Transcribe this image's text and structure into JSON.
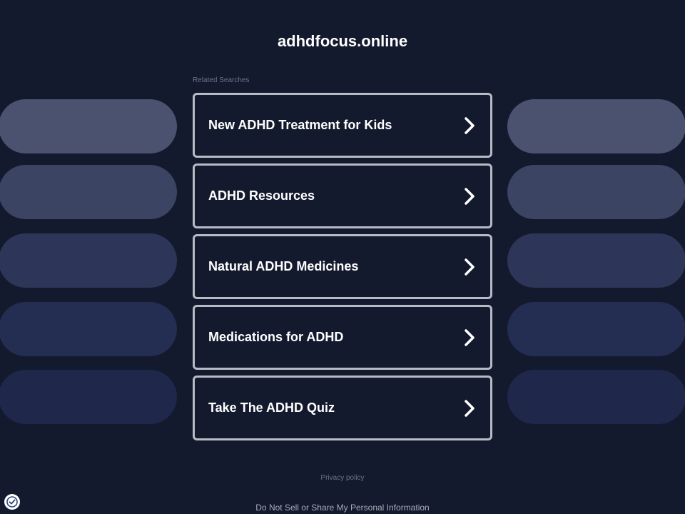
{
  "site": {
    "title": "adhdfocus.online"
  },
  "related": {
    "label": "Related Searches",
    "links": [
      {
        "label": "New ADHD Treatment for Kids"
      },
      {
        "label": "ADHD Resources"
      },
      {
        "label": "Natural ADHD Medicines"
      },
      {
        "label": "Medications for ADHD"
      },
      {
        "label": "Take The ADHD Quiz"
      }
    ]
  },
  "footer": {
    "privacy": "Privacy policy",
    "do_not_sell": "Do Not Sell or Share My Personal Information"
  },
  "icons": {
    "link_arrow": "chevron-right-icon",
    "consent": "privacy-consent-icon"
  },
  "colors": {
    "background": "#141a2e",
    "card_border": "#b7bbc4",
    "decor_shades": [
      "#4a5270",
      "#3b4463",
      "#2d3658",
      "#242d52",
      "#1f284a"
    ]
  }
}
